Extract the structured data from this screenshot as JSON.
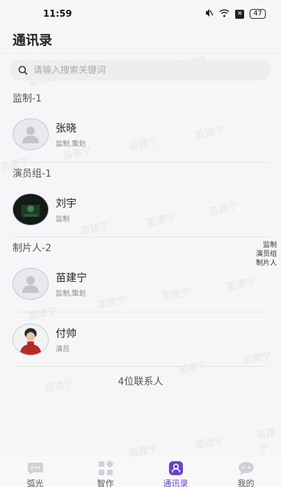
{
  "status_bar": {
    "time": "11:59",
    "battery": "47"
  },
  "header": {
    "title": "通讯录"
  },
  "search": {
    "placeholder": "请输入搜索关键词"
  },
  "sections": [
    {
      "title": "监制-1",
      "contacts": [
        {
          "name": "张晓",
          "role": "监制,策划",
          "avatar": "placeholder"
        }
      ]
    },
    {
      "title": "演员组-1",
      "contacts": [
        {
          "name": "刘宇",
          "role": "监制",
          "avatar": "photo-dark"
        }
      ]
    },
    {
      "title": "制片人-2",
      "contacts": [
        {
          "name": "苗建宁",
          "role": "监制,策划",
          "avatar": "placeholder"
        },
        {
          "name": "付帅",
          "role": "演员",
          "avatar": "photo-person"
        }
      ]
    }
  ],
  "index_bar": [
    "监制",
    "演员组",
    "制片人"
  ],
  "footer": {
    "count_text": "4位联系人"
  },
  "watermark": "苗建宁",
  "tabs": [
    {
      "label": "弧光",
      "icon": "chat-bubble-icon",
      "active": false
    },
    {
      "label": "智作",
      "icon": "apps-grid-icon",
      "active": false
    },
    {
      "label": "通讯录",
      "icon": "contacts-icon",
      "active": true
    },
    {
      "label": "我的",
      "icon": "message-icon",
      "active": false
    }
  ],
  "colors": {
    "accent": "#6a42c8"
  }
}
